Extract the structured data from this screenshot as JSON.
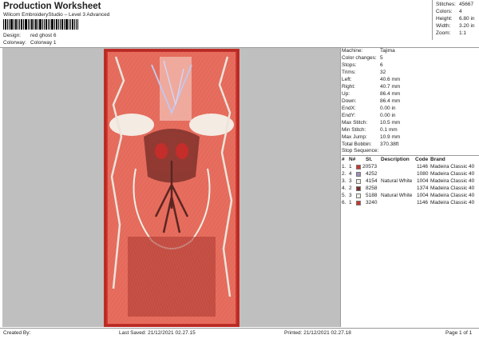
{
  "header": {
    "title": "Production Worksheet",
    "subtitle": "Wilcom EmbroideryStudio – Level 3 Advanced"
  },
  "design_info": [
    {
      "label": "Design:",
      "value": "red ghost 6"
    },
    {
      "label": "Colorway:",
      "value": "Colorway 1"
    }
  ],
  "summary": [
    {
      "label": "Stitches:",
      "value": "45667"
    },
    {
      "label": "Colors:",
      "value": "4"
    },
    {
      "label": "Height:",
      "value": "6.80 in"
    },
    {
      "label": "Width:",
      "value": "3.20 in"
    },
    {
      "label": "Zoom:",
      "value": "1:1"
    }
  ],
  "machine_details": [
    {
      "label": "Machine:",
      "value": "Tajima"
    },
    {
      "label": "Color changes:",
      "value": "5"
    },
    {
      "label": "Stops:",
      "value": "6"
    },
    {
      "label": "Trims:",
      "value": "32"
    },
    {
      "label": "Left:",
      "value": "40.6 mm"
    },
    {
      "label": "Right:",
      "value": "40.7 mm"
    },
    {
      "label": "Up:",
      "value": "86.4 mm"
    },
    {
      "label": "Down:",
      "value": "86.4 mm"
    },
    {
      "label": "EndX:",
      "value": "0.00 in"
    },
    {
      "label": "EndY:",
      "value": "0.00 in"
    },
    {
      "label": "Max Stitch:",
      "value": "10.5 mm"
    },
    {
      "label": "Min Stitch:",
      "value": "0.1 mm"
    },
    {
      "label": "Max Jump:",
      "value": "10.9 mm"
    },
    {
      "label": "Total Bobbin:",
      "value": "370.38ft"
    }
  ],
  "stop_sequence": {
    "title": "Stop Sequence:",
    "headers": {
      "num": "#",
      "n": "N#",
      "st": "St.",
      "desc": "Description",
      "code": "Code",
      "brand": "Brand"
    },
    "rows": [
      {
        "num": "1.",
        "n": "1",
        "color": "#c8372f",
        "st": "20573",
        "desc": "",
        "code": "1146",
        "brand": "Madeira Classic 40"
      },
      {
        "num": "2.",
        "n": "4",
        "color": "#9d8fb8",
        "st": "4252",
        "desc": "",
        "code": "1080",
        "brand": "Madeira Classic 40"
      },
      {
        "num": "3.",
        "n": "3",
        "color": "#f2efe6",
        "st": "4154",
        "desc": "Natural White",
        "code": "1004",
        "brand": "Madeira Classic 40"
      },
      {
        "num": "4.",
        "n": "2",
        "color": "#7a2f2a",
        "st": "8258",
        "desc": "",
        "code": "1374",
        "brand": "Madeira Classic 40"
      },
      {
        "num": "5.",
        "n": "3",
        "color": "#f2efe6",
        "st": "5188",
        "desc": "Natural White",
        "code": "1004",
        "brand": "Madeira Classic 40"
      },
      {
        "num": "6.",
        "n": "1",
        "color": "#c8372f",
        "st": "3240",
        "desc": "",
        "code": "1146",
        "brand": "Madeira Classic 40"
      }
    ]
  },
  "footer": {
    "created_by": "Created By:",
    "last_saved": "Last Saved: 21/12/2021 02.27.15",
    "printed": "Printed: 21/12/2021 02.27.18",
    "page": "Page 1 of 1"
  }
}
